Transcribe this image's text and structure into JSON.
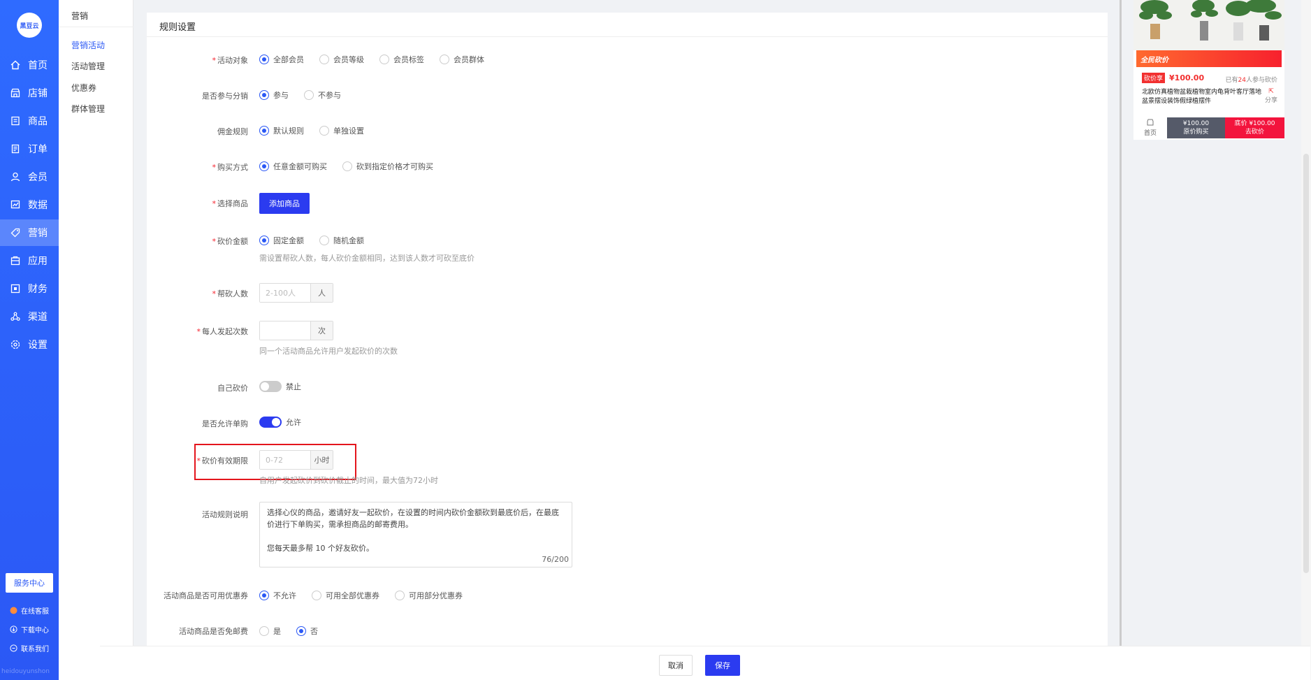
{
  "brand": {
    "logo_text": "黑豆云",
    "footer_text": "heidouyunshon"
  },
  "main_nav": [
    {
      "label": "首页",
      "icon": "home-icon"
    },
    {
      "label": "店铺",
      "icon": "store-icon"
    },
    {
      "label": "商品",
      "icon": "goods-icon"
    },
    {
      "label": "订单",
      "icon": "order-icon"
    },
    {
      "label": "会员",
      "icon": "member-icon"
    },
    {
      "label": "数据",
      "icon": "chart-icon"
    },
    {
      "label": "营销",
      "icon": "tag-icon",
      "active": true
    },
    {
      "label": "应用",
      "icon": "app-icon"
    },
    {
      "label": "财务",
      "icon": "finance-icon"
    },
    {
      "label": "渠道",
      "icon": "channel-icon"
    },
    {
      "label": "设置",
      "icon": "gear-icon"
    }
  ],
  "service_center": "服务中心",
  "bottom_links": [
    {
      "label": "在线客服",
      "icon": "chat-icon"
    },
    {
      "label": "下载中心",
      "icon": "download-icon"
    },
    {
      "label": "联系我们",
      "icon": "contact-icon"
    }
  ],
  "sub_nav": {
    "header": "营销",
    "items": [
      "营销活动",
      "活动管理",
      "优惠券",
      "群体管理"
    ],
    "active_index": 0
  },
  "section_title": "规则设置",
  "form": {
    "target": {
      "label": "活动对象",
      "required": true,
      "options": [
        "全部会员",
        "会员等级",
        "会员标签",
        "会员群体"
      ],
      "selected": 0
    },
    "distribution": {
      "label": "是否参与分销",
      "options": [
        "参与",
        "不参与"
      ],
      "selected": 0
    },
    "commission": {
      "label": "佣金规则",
      "options": [
        "默认规则",
        "单独设置"
      ],
      "selected": 0
    },
    "purchase": {
      "label": "购买方式",
      "required": true,
      "options": [
        "任意金额可购买",
        "砍到指定价格才可购买"
      ],
      "selected": 0
    },
    "goods": {
      "label": "选择商品",
      "required": true,
      "button": "添加商品"
    },
    "amount": {
      "label": "砍价金额",
      "required": true,
      "options": [
        "固定金额",
        "随机金额"
      ],
      "selected": 0,
      "hint": "需设置帮砍人数，每人砍价金额相同，达到该人数才可砍至底价"
    },
    "helpers": {
      "label": "帮砍人数",
      "required": true,
      "placeholder": "2-100人",
      "unit": "人"
    },
    "times": {
      "label": "每人发起次数",
      "required": true,
      "placeholder": "",
      "unit": "次",
      "hint": "同一个活动商品允许用户发起砍价的次数"
    },
    "self_cut": {
      "label": "自己砍价",
      "status": "禁止",
      "enabled": false
    },
    "single_buy": {
      "label": "是否允许单购",
      "status": "允许",
      "enabled": true
    },
    "validity": {
      "label": "砍价有效期限",
      "required": true,
      "placeholder": "0-72",
      "unit": "小时",
      "hint": "自用户发起砍价到砍价截止的时间，最大值为72小时"
    },
    "rules": {
      "label": "活动规则说明",
      "line1": "选择心仪的商品，邀请好友一起砍价，在设置的时间内砍价金额砍到最底价后，在最底",
      "line2": "价进行下单购买，需承担商品的邮寄费用。",
      "line3": "您每天最多帮  10 个好友砍价。",
      "counter": "76/200"
    },
    "coupon": {
      "label": "活动商品是否可用优惠券",
      "options": [
        "不允许",
        "可用全部优惠券",
        "可用部分优惠券"
      ],
      "selected": 0
    },
    "free_ship": {
      "label": "活动商品是否免邮费",
      "options": [
        "是",
        "否"
      ],
      "selected": 1
    }
  },
  "actions": {
    "cancel": "取消",
    "save": "保存"
  },
  "preview": {
    "banner": "全民砍价",
    "tag": "砍价享",
    "price": "¥100.00",
    "joined_prefix": "已有",
    "joined_count": "24",
    "joined_suffix": "人参与砍价",
    "product_name": "北欧仿真植物盆栽植物室内龟背叶客厅落地盆景摆设装饰假绿植摆件",
    "share": "分享",
    "home": "首页",
    "orig_price": "¥100.00",
    "orig_label": "原价购买",
    "floor_label": "底价 ¥100.00",
    "cut_label": "去砍价"
  },
  "colors": {
    "primary": "#2b3bf0",
    "nav": "#2b58f5",
    "danger": "#f23030",
    "highlight_box": "#e4151c"
  }
}
